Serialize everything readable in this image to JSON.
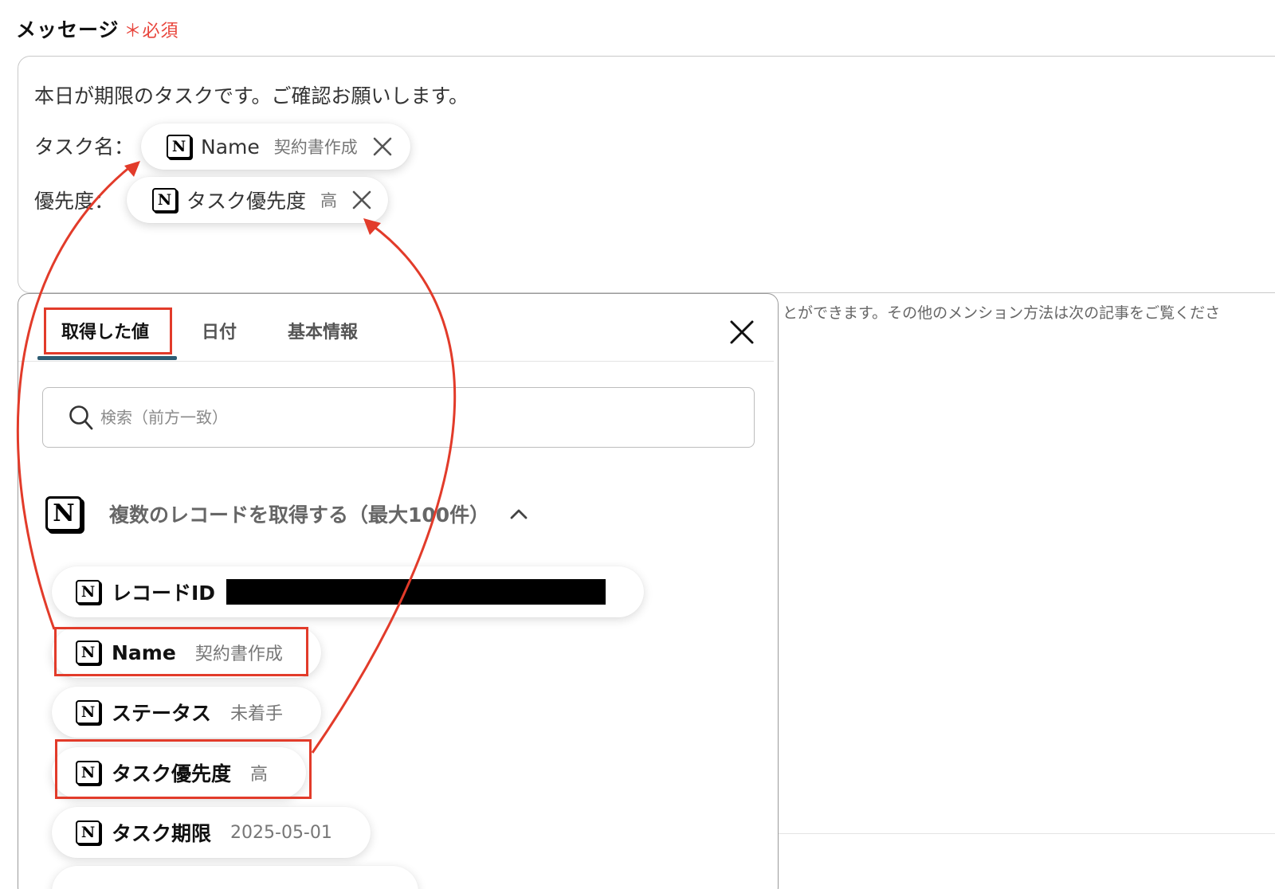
{
  "field": {
    "label": "メッセージ",
    "required_mark": "＊",
    "required_text": "必須"
  },
  "message": {
    "line1": "本日が期限のタスクです。ご確認お願いします。",
    "task_name_label": "タスク名：",
    "priority_label": "優先度：",
    "chip_name": {
      "key": "Name",
      "value": "契約書作成"
    },
    "chip_priority": {
      "key": "タスク優先度",
      "value": "高"
    }
  },
  "side_note": "とができます。その他のメンション方法は次の記事をご覧くださ",
  "panel": {
    "tabs": [
      {
        "label": "取得した値",
        "active": true
      },
      {
        "label": "日付",
        "active": false
      },
      {
        "label": "基本情報",
        "active": false
      }
    ],
    "search_placeholder": "検索（前方一致）",
    "section_title": "複数のレコードを取得する（最大100件）",
    "items": [
      {
        "key": "レコードID",
        "value": "",
        "redacted": true
      },
      {
        "key": "Name",
        "value": "契約書作成",
        "highlighted": true
      },
      {
        "key": "ステータス",
        "value": "未着手"
      },
      {
        "key": "タスク優先度",
        "value": "高",
        "highlighted": true
      },
      {
        "key": "タスク期限",
        "value": "2025-05-01"
      }
    ]
  },
  "icons": {
    "app": "notion-icon",
    "remove": "close-icon",
    "search": "search-icon",
    "collapse": "chevron-up-icon"
  },
  "colors": {
    "required": "#e8453c",
    "highlight": "#e23b2a",
    "tab_underline": "#2d5c73"
  }
}
